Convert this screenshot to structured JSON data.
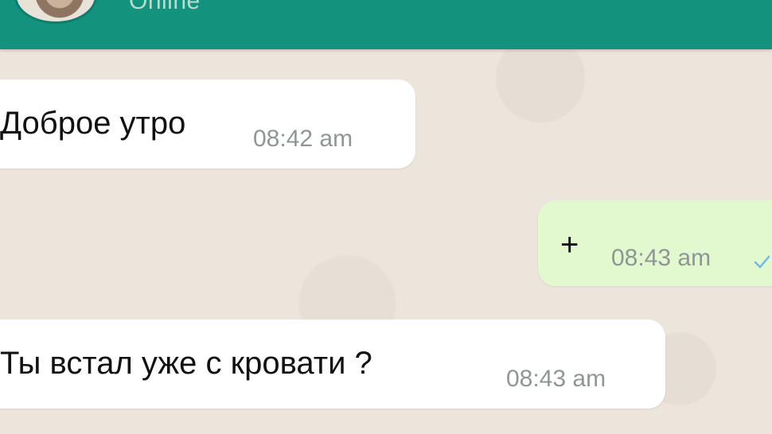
{
  "header": {
    "status": "Online",
    "background": "#13927e"
  },
  "messages": [
    {
      "direction": "incoming",
      "text": "Доброе утро",
      "time": "08:42 am"
    },
    {
      "direction": "outgoing",
      "text": "+",
      "time": "08:43 am",
      "status_icon": "check-icon"
    },
    {
      "direction": "incoming",
      "text": "Ты встал уже с кровати ?",
      "time": "08:43 am"
    }
  ],
  "colors": {
    "incoming_bubble": "#ffffff",
    "outgoing_bubble": "#e2f8cf",
    "chat_background": "#ece5dc"
  }
}
